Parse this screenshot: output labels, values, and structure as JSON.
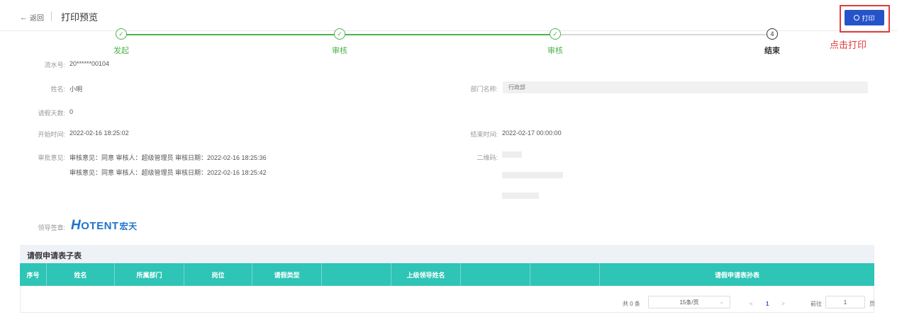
{
  "header": {
    "back_label": "返回",
    "title": "打印预览",
    "print_label": "打印",
    "print_hint": "点击打印"
  },
  "steps": [
    {
      "label": "发起",
      "state": "done",
      "mark": "✓"
    },
    {
      "label": "审核",
      "state": "done",
      "mark": "✓"
    },
    {
      "label": "审核",
      "state": "done",
      "mark": "✓"
    },
    {
      "label": "结束",
      "state": "current",
      "mark": "4"
    }
  ],
  "form": {
    "serial_label": "流水号:",
    "serial_value": "20******00104",
    "name_label": "姓名:",
    "name_value": "小明",
    "dept_label": "部门名称:",
    "dept_value": "行政部",
    "days_label": "请假天数:",
    "days_value": "0",
    "start_label": "开始时间:",
    "start_value": "2022-02-16 18:25:02",
    "end_label": "结束时间:",
    "end_value": "2022-02-17 00:00:00",
    "approval_label": "审批意见:",
    "approvals": [
      "审核意见：同意 审核人：超级管理员 审核日期：2022-02-16 18:25:36",
      "审核意见：同意 审核人：超级管理员 审核日期：2022-02-16 18:25:42"
    ],
    "qrcode_label": "二维码:",
    "seal_label": "领导签章:",
    "seal_logo": "HOTENT宏天"
  },
  "subtable": {
    "title": "请假申请表子表",
    "columns": [
      "序号",
      "姓名",
      "所属部门",
      "岗位",
      "请假类型",
      "",
      "上级领导姓名",
      "",
      "",
      "请假申请表孙表"
    ]
  },
  "pagination": {
    "total": "共 0 条",
    "page_size": "15条/页",
    "prev": "<",
    "page": "1",
    "next": ">",
    "goto_label": "前往",
    "goto_value": "1",
    "page_unit": "页"
  },
  "colors": {
    "accent": "#2653c9",
    "success": "#4cb44c",
    "table_header": "#2ec4b6",
    "highlight": "#e23b3b"
  }
}
